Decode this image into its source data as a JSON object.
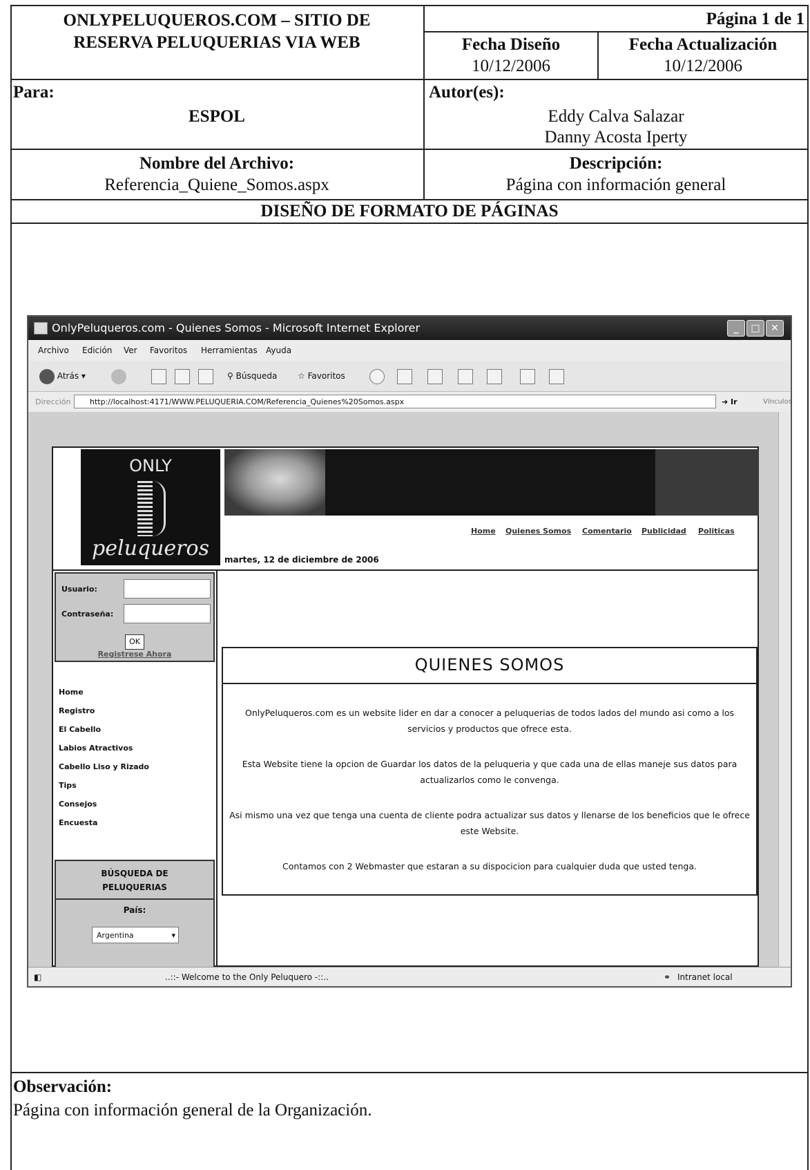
{
  "header": {
    "title_line1": "ONLYPELUQUEROS.COM – SITIO DE",
    "title_line2": "RESERVA PELUQUERIAS VIA WEB",
    "page": "Página 1 de 1",
    "design_date_label": "Fecha Diseño",
    "design_date": "10/12/2006",
    "update_date_label": "Fecha Actualización",
    "update_date": "10/12/2006",
    "para_label": "Para:",
    "para_value": "ESPOL",
    "authors_label": "Autor(es):",
    "author1": "Eddy Calva Salazar",
    "author2": "Danny Acosta Iperty",
    "filename_label": "Nombre del Archivo:",
    "filename": "Referencia_Quiene_Somos.aspx",
    "description_label": "Descripción:",
    "description": "Página  con información general",
    "section_title": "DISEÑO DE FORMATO DE PÁGINAS"
  },
  "browser": {
    "window_title": "OnlyPeluqueros.com - Quienes Somos - Microsoft Internet Explorer",
    "menu": [
      "Archivo",
      "Edición",
      "Ver",
      "Favoritos",
      "Herramientas",
      "Ayuda"
    ],
    "back_label": "Atrás",
    "search_label": "Búsqueda",
    "favorites_label": "Favoritos",
    "address_label": "Dirección",
    "url": "http://localhost:4171/WWW.PELUQUERIA.COM/Referencia_Quienes%20Somos.aspx",
    "go_label": "Ir",
    "links_label": "Vínculos",
    "status_text": "..::- Welcome to the Only Peluquero -::..",
    "zone_text": "Intranet local"
  },
  "site": {
    "logo_top": "ONLY",
    "logo_bottom": "peluqueros",
    "nav": [
      "Home",
      "Quienes Somos",
      "Comentario",
      "Publicidad",
      "Politicas"
    ],
    "date": "martes, 12 de diciembre de 2006",
    "user_label": "Usuario:",
    "password_label": "Contraseña:",
    "ok_label": "OK",
    "register_link": "Registrese Ahora",
    "menu": [
      "Home",
      "Registro",
      "El Cabello",
      "Labios Atractivos",
      "Cabello Liso y Rizado",
      "Tips",
      "Consejos",
      "Encuesta"
    ],
    "search_title_1": "BÚSQUEDA DE",
    "search_title_2": "PELUQUERIAS",
    "country_label": "País:",
    "country_value": "Argentina",
    "about_title": "QUIENES SOMOS",
    "about_paragraphs": [
      "OnlyPeluqueros.com es un  website lider en dar a conocer a peluquerias de todos lados del mundo asi como a los servicios y productos que ofrece esta.",
      "Esta Website tiene la opcion de Guardar los datos de la peluqueria y que cada una de ellas maneje sus datos para actualizarlos como le convenga.",
      "Asi mismo una vez que tenga una cuenta de cliente podra actualizar sus datos y llenarse de los beneficios que le ofrece este Website.",
      "Contamos con 2 Webmaster que estaran a su dispocicion para cualquier duda que usted tenga."
    ]
  },
  "footer": {
    "observation_label": "Observación:",
    "observation_text": "Página  con información general de la Organización."
  }
}
